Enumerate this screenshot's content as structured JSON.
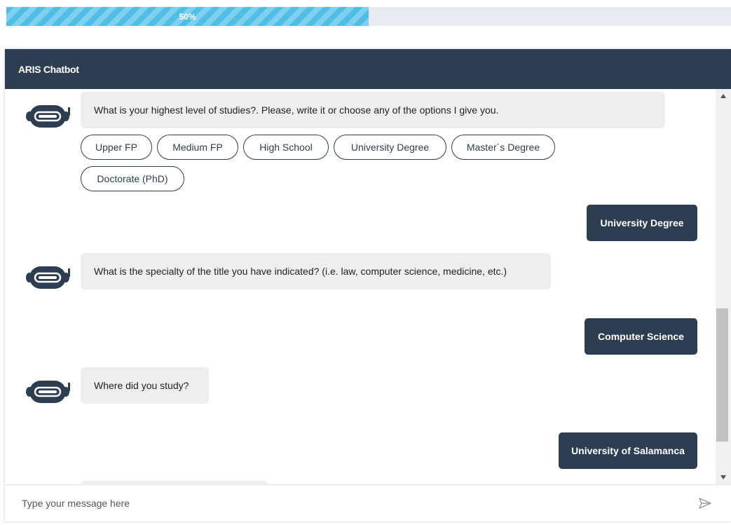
{
  "progress": {
    "value": 0.5,
    "label": "50%"
  },
  "header": {
    "title": "ARIS Chatbot"
  },
  "messages": {
    "q1": "What is your highest level of studies?. Please, write it or choose any of the options I give you.",
    "options": [
      "Upper FP",
      "Medium FP",
      "High School",
      "University Degree",
      "Master´s Degree",
      "Doctorate (PhD)"
    ],
    "a1": "University Degree",
    "q2": "What is the specialty of the title you have indicated? (i.e. law, computer science, medicine, etc.)",
    "a2": "Computer Science",
    "q3": "Where did you study?",
    "a3": "University of Salamanca"
  },
  "input": {
    "placeholder": "Type your message here"
  },
  "icons": {
    "bot": "robot-icon",
    "send": "send-icon"
  },
  "colors": {
    "primary": "#2e3e52",
    "progress": "#50bde6",
    "bot_bubble": "#eeeeee"
  }
}
